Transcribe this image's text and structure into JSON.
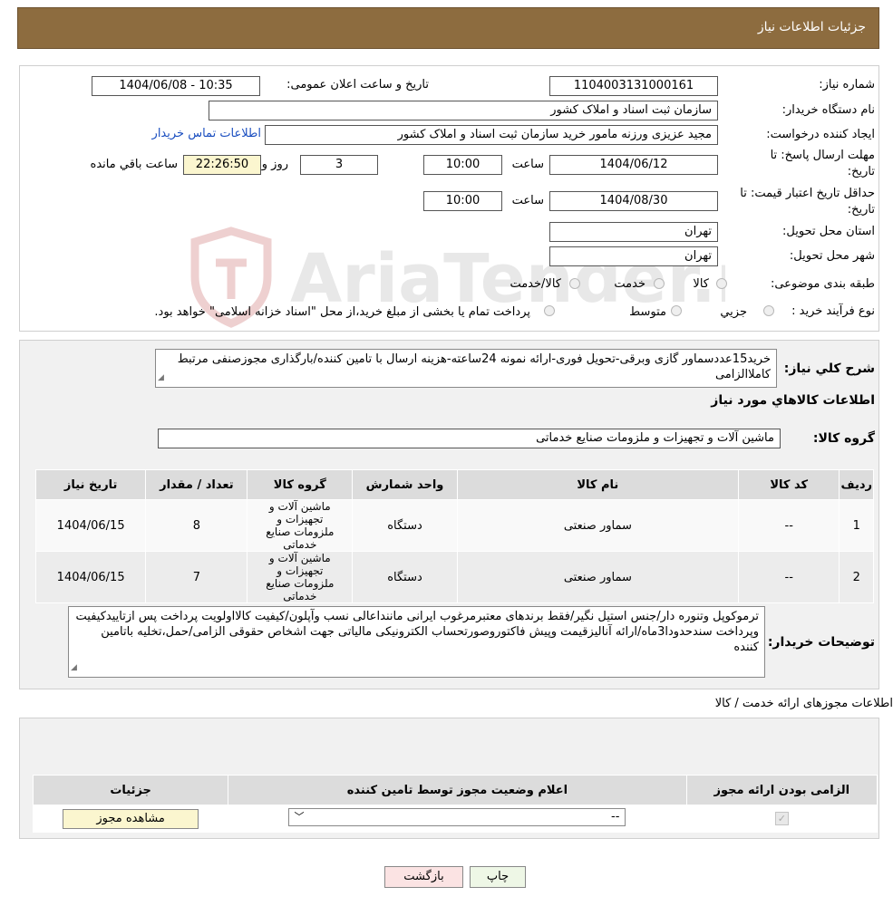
{
  "header": {
    "title": "جزئیات اطلاعات نیاز"
  },
  "info": {
    "need_number_label": "شماره نیاز:",
    "need_number": "1104003131000161",
    "announce_label": "تاریخ و ساعت اعلان عمومی:",
    "announce_value": "1404/06/08 - 10:35",
    "buyer_org_label": "نام دستگاه خریدار:",
    "buyer_org": "سازمان ثبت اسناد و املاک کشور",
    "creator_label": "ایجاد کننده درخواست:",
    "creator": "مجید عزیزی ورزنه مامور خرید سازمان ثبت اسناد و املاک کشور",
    "contact_link": "اطلاعات تماس خریدار",
    "deadline_label_1": "مهلت ارسال پاسخ: تا",
    "deadline_label_2": "تاریخ:",
    "deadline_date": "1404/06/12",
    "time_label": "ساعت",
    "deadline_time": "10:00",
    "days": "3",
    "days_label": "روز و",
    "remaining_time": "22:26:50",
    "remaining_label": "ساعت باقي مانده",
    "validity_label_1": "حداقل تاریخ اعتبار قیمت: تا",
    "validity_label_2": "تاریخ:",
    "validity_date": "1404/08/30",
    "validity_time_label": "ساعت",
    "validity_time": "10:00",
    "province_label": "استان محل تحویل:",
    "province": "تهران",
    "city_label": "شهر محل تحویل:",
    "city": "تهران",
    "category_label": "طبقه بندی موضوعی:",
    "category_options": [
      "کالا",
      "خدمت",
      "کالا/خدمت"
    ],
    "process_label": "نوع فرآیند خرید :",
    "process_options": [
      "جزيي",
      "متوسط"
    ],
    "process_note": "پرداخت تمام یا بخشی از مبلغ خرید،از محل \"اسناد خزانه اسلامی\" خواهد بود."
  },
  "description": {
    "label": "شرح کلي نياز:",
    "text": "خرید15عددسماور گازی وبرقی-تحویل فوری-ارائه نمونه 24ساعته-هزینه ارسال با تامین کننده/بارگذاری مجوزصنفی مرتبط کاملاالزامی"
  },
  "goods": {
    "section_title": "اطلاعات کالاهاي مورد نياز",
    "group_label": "گروه کالا:",
    "group_value": "ماشین آلات و تجهیزات و ملزومات صنایع خدماتی",
    "columns": [
      "رديف",
      "کد کالا",
      "نام کالا",
      "واحد شمارش",
      "گروه کالا",
      "تعداد / مقدار",
      "تاریخ نیاز"
    ],
    "rows": [
      {
        "idx": "1",
        "code": "--",
        "name": "سماور صنعتی",
        "unit": "دستگاه",
        "group": "ماشین آلات و تجهیزات و ملزومات صنایع خدماتی",
        "qty": "8",
        "date": "1404/06/15"
      },
      {
        "idx": "2",
        "code": "--",
        "name": "سماور صنعتی",
        "unit": "دستگاه",
        "group": "ماشین آلات و تجهیزات و ملزومات صنایع خدماتی",
        "qty": "7",
        "date": "1404/06/15"
      }
    ]
  },
  "buyer_notes": {
    "label": "توضیحات خریدار:",
    "text": "ترموکوپل وتنوره دار/جنس استیل نگیر/فقط برندهای معتبرمرغوب ایرانی ماننداعالی نسب وآپلون/کیفیت کالااولویت پرداخت پس ازتاییدکیفیت وپرداخت سندحدودا3ماه/ارائه آنالیزقیمت وپیش فاکتوروصورتحساب الکترونیکی مالیاتی جهت اشخاص حقوقی الزامی/حمل،تخلیه باتامین کننده"
  },
  "permits": {
    "section_title": "اطلاعات مجوزهای ارائه خدمت / کالا",
    "columns": [
      "الزامی بودن ارائه مجوز",
      "اعلام وضعیت مجوز توسط تامین کننده",
      "جزئیات"
    ],
    "select_value": "--",
    "view_button": "مشاهده مجوز"
  },
  "footer": {
    "print": "چاپ",
    "back": "بازگشت"
  },
  "watermark": {
    "text": "AriaTender.neT"
  },
  "colors": {
    "header_bg": "#8d6c3f",
    "panel_bg": "#f1f1f1",
    "table_head": "#dcdcdc",
    "row_bg": "#efefef",
    "link": "#1b4fc0",
    "back_button": "#fbe3e3",
    "print_button": "#eef7e6"
  }
}
